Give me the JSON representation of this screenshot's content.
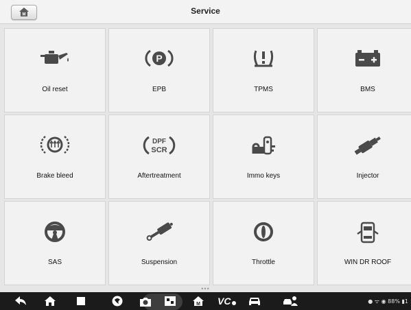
{
  "header": {
    "title": "Service",
    "home_icon": "home-m-icon"
  },
  "tiles": [
    {
      "label": "Oil reset",
      "icon": "oil-can-icon"
    },
    {
      "label": "EPB",
      "icon": "parking-brake-icon"
    },
    {
      "label": "TPMS",
      "icon": "tire-pressure-icon"
    },
    {
      "label": "BMS",
      "icon": "battery-icon"
    },
    {
      "label": "Brake bleed",
      "icon": "brake-warning-icon"
    },
    {
      "label": "Aftertreatment",
      "icon": "dpf-scr-icon"
    },
    {
      "label": "Immo keys",
      "icon": "immo-key-icon"
    },
    {
      "label": "Injector",
      "icon": "injector-icon"
    },
    {
      "label": "SAS",
      "icon": "steering-wheel-icon"
    },
    {
      "label": "Suspension",
      "icon": "shock-absorber-icon"
    },
    {
      "label": "Throttle",
      "icon": "throttle-body-icon"
    },
    {
      "label": "WIN DR ROOF",
      "icon": "car-doors-icon"
    }
  ],
  "page_indicator": "•••",
  "navbar": {
    "items": [
      "back-icon",
      "home-icon",
      "recent-apps-icon",
      "browser-icon",
      "camera-icon",
      "display-icon",
      "home-m-icon",
      "vci-icon",
      "car-icon",
      "remote-support-icon"
    ],
    "vci_label": "VC",
    "status": "● ᯤ ◉ 88% ▮1"
  },
  "colors": {
    "background": "#e6e6e6",
    "tile": "#f2f2f2",
    "icon": "#4a4a4a",
    "navbar": "#1b1b1b"
  }
}
